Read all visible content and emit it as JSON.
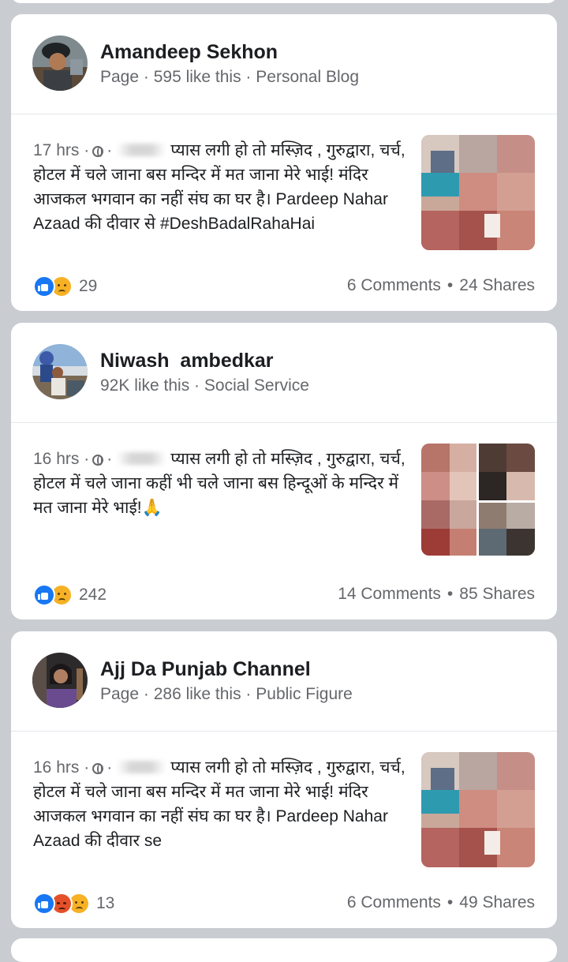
{
  "posts": [
    {
      "page_name": "Amandeep Sekhon",
      "page_meta": "Page · 595 like this · Personal Blog",
      "time": "17 hrs",
      "text": "प्यास लगी हो तो मस्ज़िद , गुरुद्वारा, चर्च, होटल में चले जाना बस मन्दिर में मत जाना मेरे भाई! मंदिर आजकल भगवान का नहीं संघ का घर है। Pardeep Nahar Azaad  की दीवार से #DeshBadalRahaHai",
      "reactions": [
        "like-icon",
        "sad-icon"
      ],
      "reaction_count": "29",
      "comments": "6 Comments",
      "shares": "24 Shares"
    },
    {
      "page_name": "Niwash  ambedkar",
      "page_meta": "92K like this · Social Service",
      "time": "16 hrs",
      "text": "प्यास लगी हो तो मस्ज़िद , गुरुद्वारा, चर्च, होटल में चले जाना कहीं भी चले जाना  बस हिन्दूओं के मन्दिर में मत जाना मेरे भाई!🙏",
      "reactions": [
        "like-icon",
        "sad-icon"
      ],
      "reaction_count": "242",
      "comments": "14 Comments",
      "shares": "85 Shares"
    },
    {
      "page_name": "Ajj Da Punjab Channel",
      "page_meta": "Page · 286 like this · Public Figure",
      "time": "16 hrs",
      "text": "प्यास लगी हो तो मस्ज़िद , गुरुद्वारा, चर्च, होटल में चले जाना बस मन्दिर में मत जाना मेरे भाई! मंदिर आजकल भगवान का नहीं संघ का घर है। Pardeep Nahar Azaad  की दीवार se",
      "reactions": [
        "like-icon",
        "angry-icon",
        "sad-icon"
      ],
      "reaction_count": "13",
      "comments": "6 Comments",
      "shares": "49 Shares"
    }
  ],
  "separator": "•",
  "colors": {
    "background": "#c9ccd1",
    "card": "#ffffff",
    "secondary_text": "#65676b",
    "like_blue": "#1877f2"
  }
}
